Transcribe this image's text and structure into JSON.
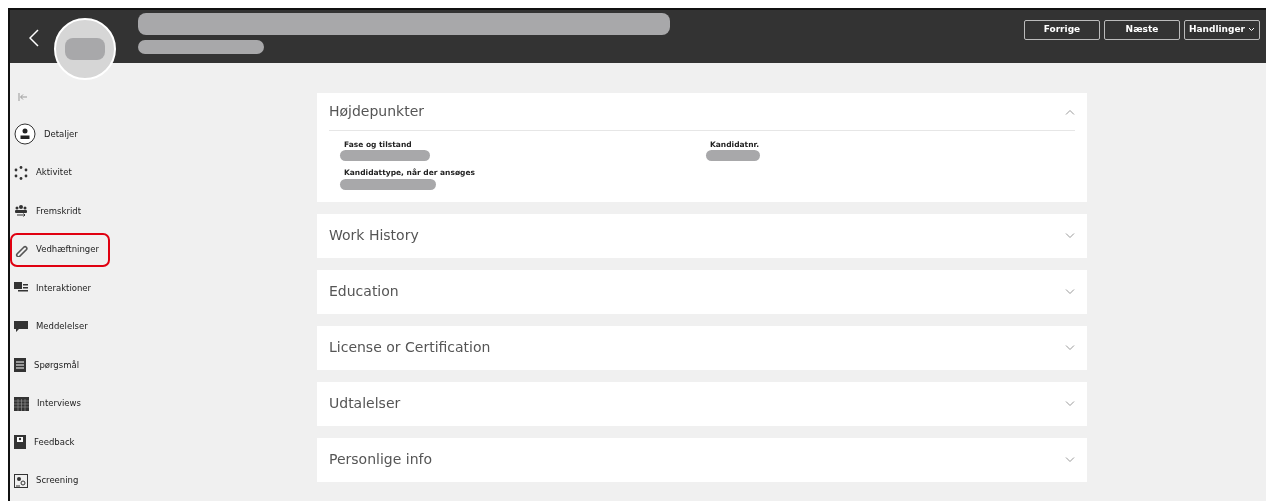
{
  "header": {
    "buttons": [
      {
        "label": "Forrige",
        "kind": "button"
      },
      {
        "label": "Næste",
        "kind": "button"
      },
      {
        "label": "Handlinger",
        "kind": "dropdown"
      }
    ]
  },
  "sidebar": {
    "items": [
      {
        "label": "Detaljer",
        "highlighted": false
      },
      {
        "label": "Aktivitet",
        "highlighted": false
      },
      {
        "label": "Fremskridt",
        "highlighted": false
      },
      {
        "label": "Vedhæftninger",
        "highlighted": true
      },
      {
        "label": "Interaktioner",
        "highlighted": false
      },
      {
        "label": "Meddelelser",
        "highlighted": false
      },
      {
        "label": "Spørgsmål",
        "highlighted": false
      },
      {
        "label": "Interviews",
        "highlighted": false
      },
      {
        "label": "Feedback",
        "highlighted": false
      },
      {
        "label": "Screening",
        "highlighted": false
      }
    ]
  },
  "sections": [
    {
      "title": "Højdepunkter",
      "expanded": true,
      "fields": [
        {
          "label": "Fase og tilstand"
        },
        {
          "label": "Kandidatnr."
        },
        {
          "label": "Kandidattype, når der ansøges"
        }
      ]
    },
    {
      "title": "Work History",
      "expanded": false
    },
    {
      "title": "Education",
      "expanded": false
    },
    {
      "title": "License or Certification",
      "expanded": false
    },
    {
      "title": "Udtalelser",
      "expanded": false
    },
    {
      "title": "Personlige info",
      "expanded": false
    }
  ]
}
